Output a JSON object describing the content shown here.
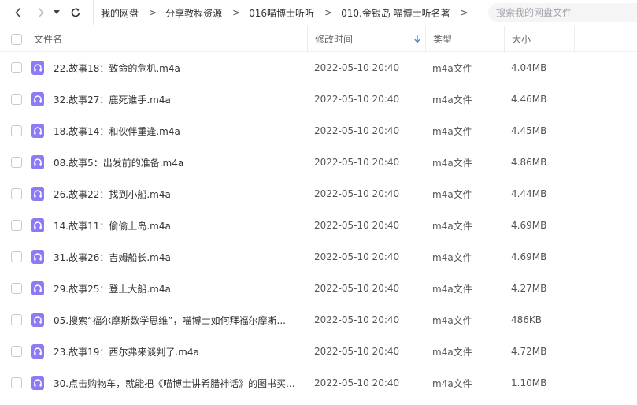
{
  "nav": {
    "back": "‹",
    "forward": "›",
    "dropdown": "▾",
    "refresh": "↻"
  },
  "breadcrumb": [
    "我的网盘",
    "分享教程资源",
    "016喵博士听听",
    "010.金银岛 喵博士听名著"
  ],
  "breadcrumb_sep": ">",
  "search": {
    "placeholder": "搜索我的网盘文件"
  },
  "columns": {
    "name": "文件名",
    "time": "修改时间",
    "type": "类型",
    "size": "大小"
  },
  "colors": {
    "audio_icon": "#8b7cf6",
    "sort_arrow": "#3a8ee6"
  },
  "files": [
    {
      "name": "22.故事18：致命的危机.m4a",
      "time": "2022-05-10 20:40",
      "type": "m4a文件",
      "size": "4.04MB"
    },
    {
      "name": "32.故事27：鹿死谁手.m4a",
      "time": "2022-05-10 20:40",
      "type": "m4a文件",
      "size": "4.46MB"
    },
    {
      "name": "18.故事14：和伙伴重逢.m4a",
      "time": "2022-05-10 20:40",
      "type": "m4a文件",
      "size": "4.45MB"
    },
    {
      "name": "08.故事5：出发前的准备.m4a",
      "time": "2022-05-10 20:40",
      "type": "m4a文件",
      "size": "4.86MB"
    },
    {
      "name": "26.故事22：找到小船.m4a",
      "time": "2022-05-10 20:40",
      "type": "m4a文件",
      "size": "4.44MB"
    },
    {
      "name": "14.故事11：偷偷上岛.m4a",
      "time": "2022-05-10 20:40",
      "type": "m4a文件",
      "size": "4.69MB"
    },
    {
      "name": "31.故事26：吉姆船长.m4a",
      "time": "2022-05-10 20:40",
      "type": "m4a文件",
      "size": "4.69MB"
    },
    {
      "name": "29.故事25：登上大船.m4a",
      "time": "2022-05-10 20:40",
      "type": "m4a文件",
      "size": "4.27MB"
    },
    {
      "name": "05.搜索“福尔摩斯数学思维”，喵博士如何拜福尔摩斯...",
      "time": "2022-05-10 20:40",
      "type": "m4a文件",
      "size": "486KB"
    },
    {
      "name": "23.故事19：西尔弗来谈判了.m4a",
      "time": "2022-05-10 20:40",
      "type": "m4a文件",
      "size": "4.72MB"
    },
    {
      "name": "30.点击购物车，就能把《喵博士讲希腊神话》的图书买...",
      "time": "2022-05-10 20:40",
      "type": "m4a文件",
      "size": "1.10MB"
    }
  ]
}
